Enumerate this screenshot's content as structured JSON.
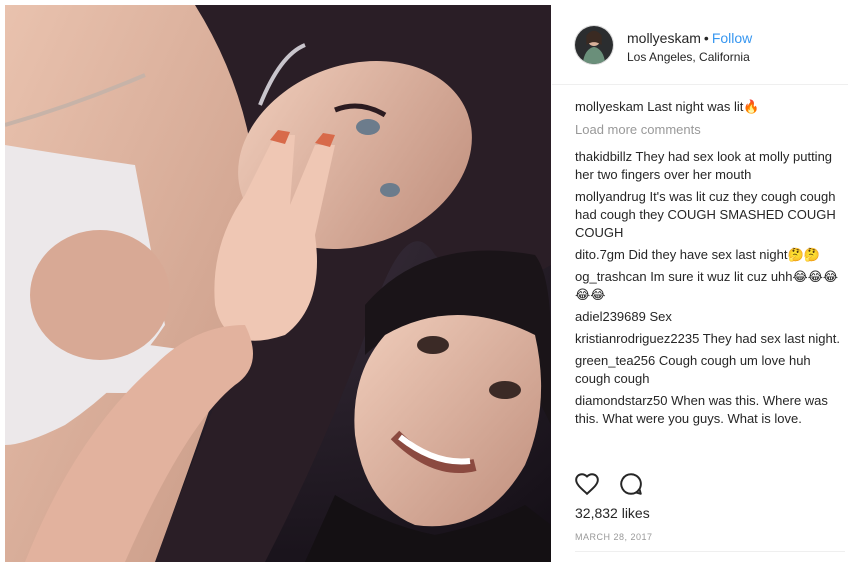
{
  "post": {
    "photo_alt": "",
    "header": {
      "username": "mollyeskam",
      "separator": "•",
      "follow_label": "Follow",
      "location": "Los Angeles, California"
    },
    "caption": {
      "username": "mollyeskam",
      "text": "Last night was lit🔥"
    },
    "load_more_label": "Load more comments",
    "comments": [
      {
        "username": "thakidbillz",
        "text": "They had sex look at molly putting her two fingers over her mouth"
      },
      {
        "username": "mollyandrug",
        "text": "It's was lit cuz they cough cough had cough they COUGH SMASHED COUGH COUGH"
      },
      {
        "username": "dito.7gm",
        "text": "Did they have sex last night🤔🤔"
      },
      {
        "username": "og_trashcan",
        "text": "Im sure it wuz lit cuz uhh😂😂😂😂😂"
      },
      {
        "username": "adiel239689",
        "text": "Sex"
      },
      {
        "username": "kristianrodriguez2235",
        "text": "They had sex last night."
      },
      {
        "username": "green_tea256",
        "text": "Cough cough um love huh cough cough"
      },
      {
        "username": "diamondstarz50",
        "text": "When was this. Where was this. What were you guys. What is love."
      }
    ],
    "icons": {
      "like": "heart-icon",
      "comment": "comment-bubble-icon"
    },
    "likes": "32,832 likes",
    "date": "MARCH 28, 2017",
    "colors": {
      "link": "#3897f0",
      "text": "#262626",
      "muted": "#999999",
      "border": "#efefef"
    }
  }
}
